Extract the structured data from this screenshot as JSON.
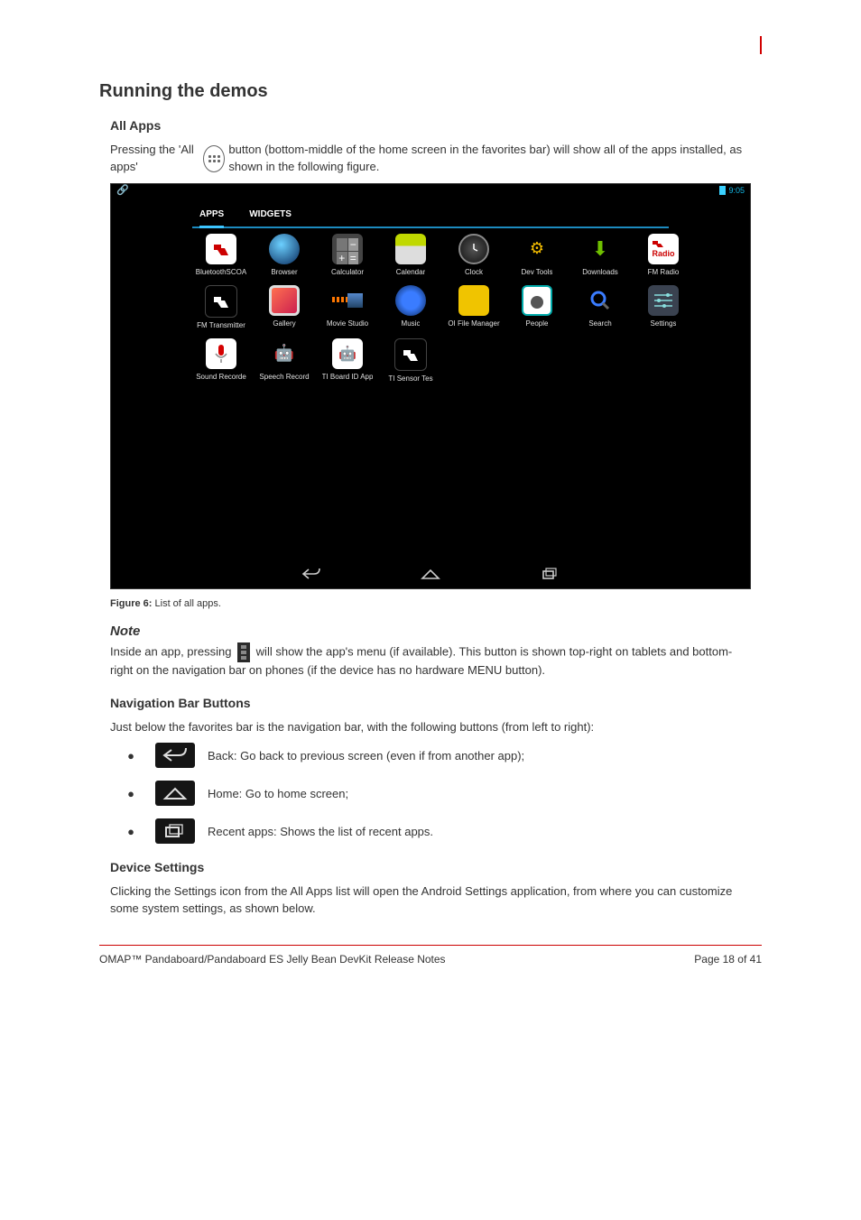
{
  "header": {
    "page_no": ""
  },
  "section_title": "Running the demos",
  "sub_apps": "All Apps",
  "apps_intro_pre": "Pressing the 'All apps' ",
  "apps_intro_post": " button (bottom-middle of the home screen in the favorites bar) will show all of the apps installed, as shown in the following figure.",
  "screenshot": {
    "status_time": "9:05",
    "tabs": {
      "apps": "APPS",
      "widgets": "WIDGETS"
    },
    "apps": [
      {
        "label": "BluetoothSCOA",
        "icon": "ti"
      },
      {
        "label": "Browser",
        "icon": "browser"
      },
      {
        "label": "Calculator",
        "icon": "calc"
      },
      {
        "label": "Calendar",
        "icon": "cal"
      },
      {
        "label": "Clock",
        "icon": "clock"
      },
      {
        "label": "Dev Tools",
        "icon": "gear"
      },
      {
        "label": "Downloads",
        "icon": "dl"
      },
      {
        "label": "FM Radio",
        "icon": "radio"
      },
      {
        "label": "FM Transmitter",
        "icon": "ti-black"
      },
      {
        "label": "Gallery",
        "icon": "gallery"
      },
      {
        "label": "Movie Studio",
        "icon": "movie"
      },
      {
        "label": "Music",
        "icon": "music"
      },
      {
        "label": "OI File Manager",
        "icon": "folder"
      },
      {
        "label": "People",
        "icon": "people"
      },
      {
        "label": "Search",
        "icon": "search"
      },
      {
        "label": "Settings",
        "icon": "settings"
      },
      {
        "label": "Sound Recorde",
        "icon": "mic"
      },
      {
        "label": "Speech Record",
        "icon": "android"
      },
      {
        "label": "TI Board ID App",
        "icon": "android-hat"
      },
      {
        "label": "TI Sensor Tes",
        "icon": "ti-black"
      }
    ]
  },
  "fig_caption_1": "Figure 6:",
  "fig_caption_2": "  List of all apps.",
  "note": {
    "head": "Note",
    "pre": "Inside an app, pressing ",
    "post": " will show the app's menu (if available). This button is shown top-right on tablets and bottom-right on the navigation bar on phones (if the device has no hardware MENU button)."
  },
  "sub_nav": "Navigation Bar Buttons",
  "nav_intro": "Just below the favorites bar is the navigation bar, with the following buttons (from left to right):",
  "nav_items": [
    {
      "bullet": "●",
      "icon": "back",
      "text": "Back: Go back to previous screen (even if from another app);"
    },
    {
      "bullet": "●",
      "icon": "home",
      "text": "Home: Go to home screen;"
    },
    {
      "bullet": "●",
      "icon": "recent",
      "text": "Recent apps: Shows the list of recent apps."
    }
  ],
  "sub_set": "Device Settings",
  "set_text": "Clicking the Settings icon from the All Apps list will open the Android Settings application, from where you can customize some system settings, as shown below.",
  "footer": {
    "left": "OMAP™ Pandaboard/Pandaboard ES Jelly Bean DevKit  Release Notes",
    "right": "Page 18 of 41"
  }
}
